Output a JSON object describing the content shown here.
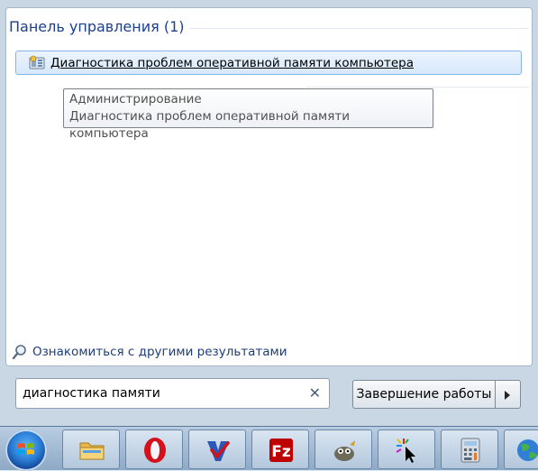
{
  "search_results": {
    "section_header": "Панель управления (1)",
    "items": [
      {
        "label": "Диагностика проблем оперативной памяти компьютера",
        "icon": "memory-diagnostic-icon"
      }
    ],
    "tooltip": {
      "line1": "Администрирование",
      "line2": "Диагностика проблем оперативной памяти компьютера"
    },
    "more_results_label": "Ознакомиться с другими результатами"
  },
  "search": {
    "value": "диагностика памяти",
    "clear_glyph": "✕"
  },
  "shutdown": {
    "label": "Завершение работы"
  },
  "taskbar": {
    "items": [
      {
        "name": "windows-explorer",
        "icon": "folder-icon"
      },
      {
        "name": "opera",
        "icon": "opera-icon"
      },
      {
        "name": "validator",
        "icon": "checkmark-v-icon"
      },
      {
        "name": "filezilla",
        "icon": "filezilla-icon"
      },
      {
        "name": "gimp",
        "icon": "gimp-icon"
      },
      {
        "name": "cursor-tool",
        "icon": "cursor-icon"
      },
      {
        "name": "calculator",
        "icon": "calculator-icon"
      },
      {
        "name": "internet",
        "icon": "globe-icon"
      }
    ]
  },
  "colors": {
    "header_text": "#1e3f8a",
    "highlight": "#d6e8fb",
    "link_text": "#1c3d7a"
  }
}
